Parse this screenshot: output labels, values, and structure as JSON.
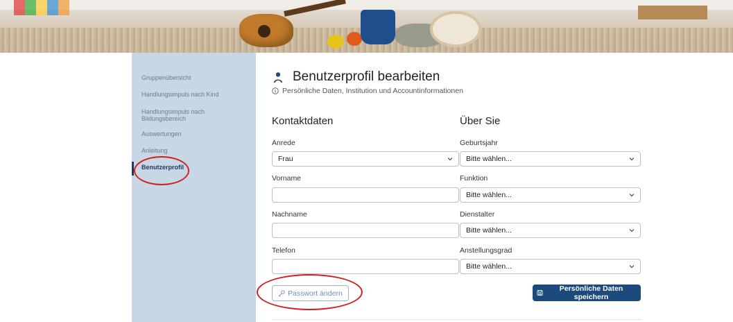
{
  "sidebar": {
    "items": [
      {
        "label": "Gruppenübersicht"
      },
      {
        "label": "Handlungsimpuls nach Kind"
      },
      {
        "label": "Handlungsimpuls nach Bildungsbereich"
      },
      {
        "label": "Auswertungen"
      },
      {
        "label": "Anleitung"
      },
      {
        "label": "Benutzerprofil",
        "active": true
      }
    ]
  },
  "header": {
    "title": "Benutzerprofil bearbeiten",
    "title_icon": "user-icon",
    "subtitle": "Persönliche Daten, Institution und Accountinformationen",
    "subtitle_icon": "info-icon"
  },
  "contact": {
    "section_title": "Kontaktdaten",
    "anrede": {
      "label": "Anrede",
      "value": "Frau"
    },
    "vorname": {
      "label": "Vorname",
      "value": ""
    },
    "nachname": {
      "label": "Nachname",
      "value": ""
    },
    "telefon": {
      "label": "Telefon",
      "value": ""
    }
  },
  "about": {
    "section_title": "Über Sie",
    "geburtsjahr": {
      "label": "Geburtsjahr",
      "value": "Bitte wählen..."
    },
    "funktion": {
      "label": "Funktion",
      "value": "Bitte wählen..."
    },
    "dienstalter": {
      "label": "Dienstalter",
      "value": "Bitte wählen..."
    },
    "anstellungsgrad": {
      "label": "Anstellungsgrad",
      "value": "Bitte wählen..."
    }
  },
  "actions": {
    "password_label": "Passwort ändern",
    "password_icon": "key-icon",
    "save_label": "Persönliche Daten speichern",
    "save_icon": "save-icon"
  },
  "colors": {
    "sidebar_bg": "#c7d7e6",
    "primary": "#1c4a7c",
    "annotation": "#d21f1f"
  }
}
